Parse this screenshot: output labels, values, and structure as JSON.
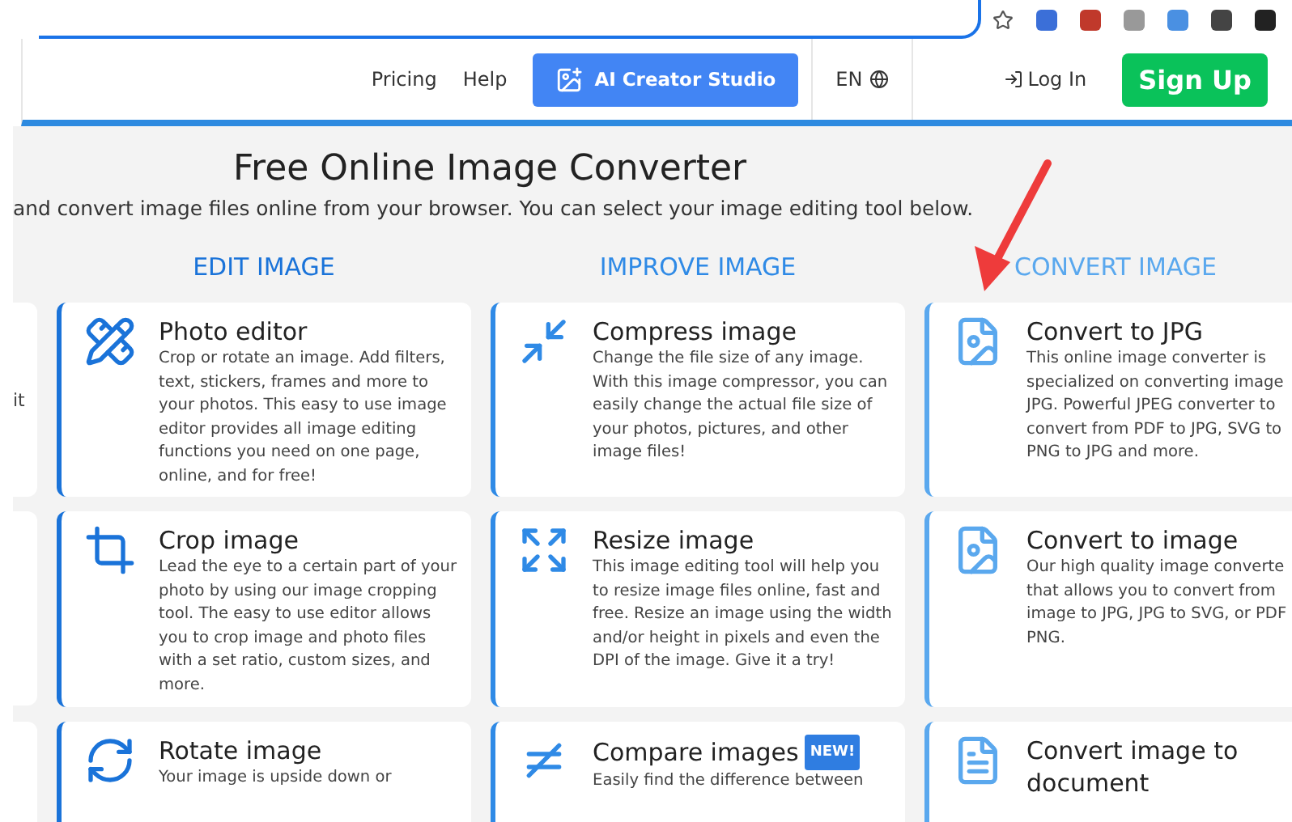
{
  "header": {
    "nav": [
      "Pricing",
      "Help"
    ],
    "ai_button": "AI Creator Studio",
    "language": "EN",
    "login": "Log In",
    "signup": "Sign Up"
  },
  "hero": {
    "title": "Free Online Image Converter",
    "subtitle": "and convert image files online from your browser. You can select your image editing tool below."
  },
  "stub_cards": [
    "it"
  ],
  "sections": [
    {
      "heading": "EDIT IMAGE",
      "color": "#1a73d9",
      "cards": [
        {
          "title": "Photo editor",
          "text": "Crop or rotate an image. Add filters, text, stickers, frames and more to your photos. This easy to use image editor provides all image editing functions you need on one page, online, and for free!"
        },
        {
          "title": "Crop image",
          "text": "Lead the eye to a certain part of your photo by using our image cropping tool. The easy to use editor allows you to crop image and photo files with a set ratio, custom sizes, and more."
        },
        {
          "title": "Rotate image",
          "text": "Your image is upside down or"
        }
      ]
    },
    {
      "heading": "IMPROVE IMAGE",
      "color": "#2f8ae6",
      "cards": [
        {
          "title": "Compress image",
          "text": "Change the file size of any image. With this image compressor, you can easily change the actual file size of your photos, pictures, and other image files!"
        },
        {
          "title": "Resize image",
          "text": "This image editing tool will help you to resize image files online, fast and free. Resize an image using the width and/or height in pixels and even the DPI of the image. Give it a try!"
        },
        {
          "title": "Compare images",
          "badge": "NEW!",
          "text": "Easily find the difference between"
        }
      ]
    },
    {
      "heading": "CONVERT IMAGE",
      "color": "#5aa8ee",
      "cards": [
        {
          "title": "Convert to JPG",
          "text": "This online image converter is specialized on converting image JPG. Powerful JPEG converter to convert from PDF to JPG, SVG to PNG to JPG and more."
        },
        {
          "title": "Convert to image",
          "text": "Our high quality image converte that allows you to convert from image to JPG, JPG to SVG, or PDF PNG."
        },
        {
          "title": "Convert image to document"
        }
      ]
    }
  ]
}
